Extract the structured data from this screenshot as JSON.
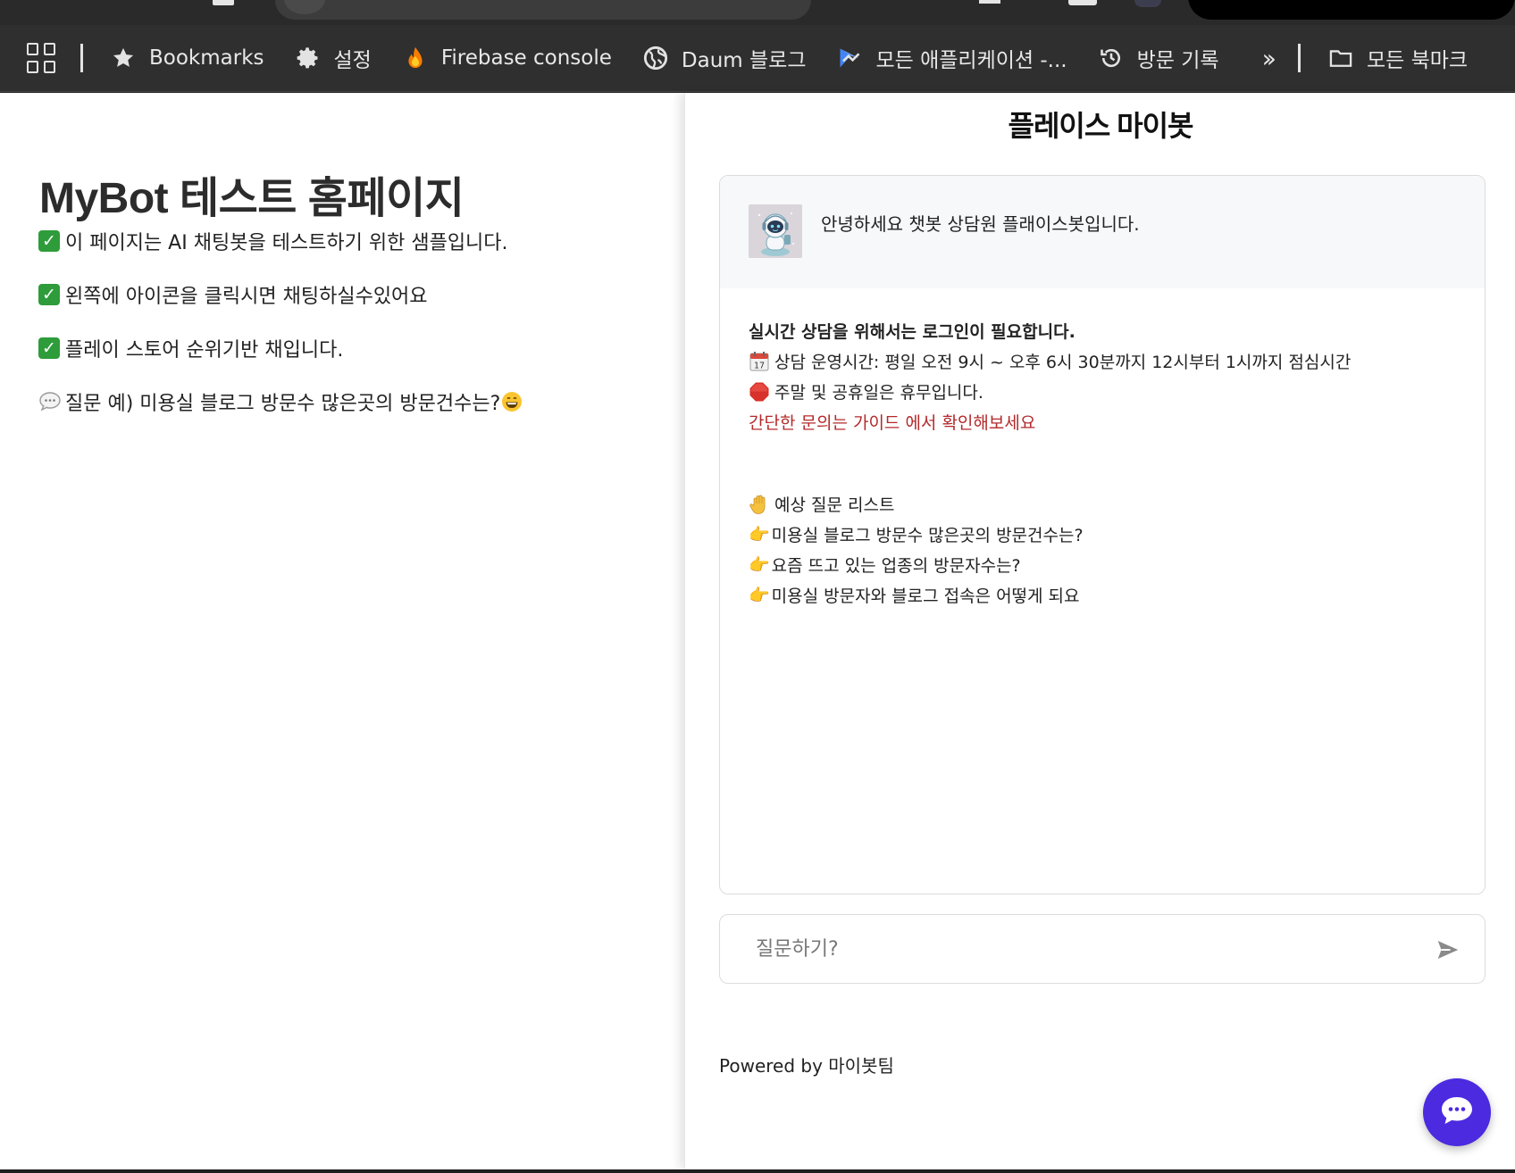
{
  "browser": {
    "bookmarks": [
      {
        "label": "Bookmarks",
        "icon": "star-icon"
      },
      {
        "label": "설정",
        "icon": "gear-icon"
      },
      {
        "label": "Firebase console",
        "icon": "firebase-icon"
      },
      {
        "label": "Daum 블로그",
        "icon": "globe-icon"
      },
      {
        "label": "모든 애플리케이션 -...",
        "icon": "app-icon"
      },
      {
        "label": "방문 기록",
        "icon": "history-icon"
      }
    ],
    "overflow_label": "»",
    "all_bookmarks_label": "모든 북마크"
  },
  "page": {
    "title": "MyBot 테스트 홈페이지",
    "lines": [
      "이 페이지는 AI 채팅봇을 테스트하기 위한 샘플입니다.",
      "왼쪽에 아이콘을 클릭시면 채팅하실수있어요",
      "플레이 스토어 순위기반 채입니다."
    ],
    "question_example": "질문 예) 미용실 블로그 방문수 많은곳의 방문건수는?"
  },
  "chat": {
    "title": "플레이스 마이봇",
    "greeting": "안녕하세요 챗봇 상담원 플래이스봇입니다.",
    "login_notice": "실시간 상담을 위해서는 로그인이 필요합니다.",
    "hours": "상담 운영시간: 평일 오전 9시 ~ 오후 6시 30분까지 12시부터 1시까지 점심시간",
    "holiday": "주말 및 공휴일은 휴무입니다.",
    "guide_link": "간단한 문의는 가이드 에서 확인해보세요",
    "faq_header": "예상 질문 리스트",
    "faq": [
      "미용실 블로그 방문수 많은곳의 방문건수는?",
      "요즘 뜨고 있는 업종의 방문자수는?",
      "미용실 방문자와 블로그 접속은 어떻게 되요"
    ],
    "input_placeholder": "질문하기?",
    "powered_by": "Powered by 마이봇팀"
  },
  "colors": {
    "accent": "#4b2ae0",
    "link": "#b3292b",
    "check": "#2e9c3a"
  }
}
